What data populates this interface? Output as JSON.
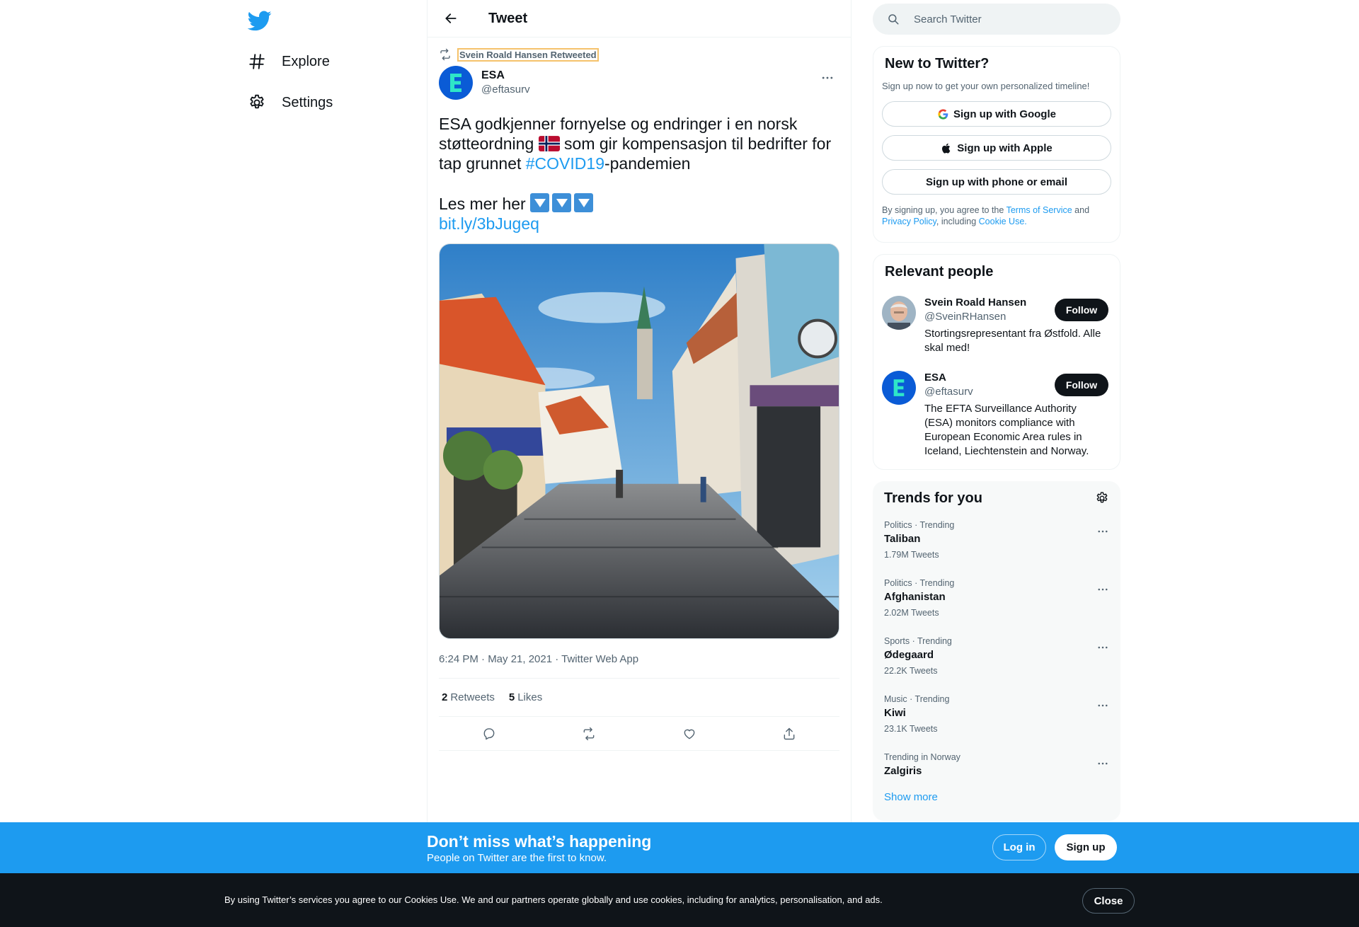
{
  "nav": {
    "explore_label": "Explore",
    "settings_label": "Settings"
  },
  "header": {
    "title": "Tweet"
  },
  "tweet": {
    "retweeted_by": "Svein Roald Hansen Retweeted",
    "author_name": "ESA",
    "author_handle": "@eftasurv",
    "text_part1": "ESA godkjenner fornyelse og endringer i en norsk støtteordning",
    "text_part2": "som gir kompensasjon til bedrifter for tap grunnet",
    "hashtag": "#COVID19",
    "text_part3": "-pandemien",
    "text_line2": "Les mer her",
    "link": "bit.ly/3bJugeq",
    "timestamp": "6:24 PM · May 21, 2021 · Twitter Web App",
    "retweets_count": "2",
    "retweets_label": "Retweets",
    "likes_count": "5",
    "likes_label": "Likes"
  },
  "search": {
    "placeholder": "Search Twitter"
  },
  "new_to_twitter": {
    "title": "New to Twitter?",
    "subtitle": "Sign up now to get your own personalized timeline!",
    "google_btn": "Sign up with Google",
    "apple_btn": "Sign up with Apple",
    "phone_btn": "Sign up with phone or email",
    "terms_prefix": "By signing up, you agree to the",
    "terms_link": "Terms of Service",
    "terms_and": "and",
    "privacy_link": "Privacy Policy",
    "terms_including": ", including",
    "cookie_link": "Cookie Use."
  },
  "relevant_people": {
    "title": "Relevant people",
    "people": [
      {
        "name": "Svein Roald Hansen",
        "handle": "@SveinRHansen",
        "bio": "Stortingsrepresentant fra Østfold. Alle skal med!",
        "follow_label": "Follow"
      },
      {
        "name": "ESA",
        "handle": "@eftasurv",
        "bio": "The EFTA Surveillance Authority (ESA) monitors compliance with European Economic Area rules in Iceland, Liechtenstein and Norway.",
        "follow_label": "Follow"
      }
    ]
  },
  "trends": {
    "title": "Trends for you",
    "items": [
      {
        "meta": "Politics · Trending",
        "name": "Taliban",
        "count": "1.79M Tweets"
      },
      {
        "meta": "Politics · Trending",
        "name": "Afghanistan",
        "count": "2.02M Tweets"
      },
      {
        "meta": "Sports · Trending",
        "name": "Ødegaard",
        "count": "22.2K Tweets"
      },
      {
        "meta": "Music · Trending",
        "name": "Kiwi",
        "count": "23.1K Tweets"
      },
      {
        "meta": "Trending in Norway",
        "name": "Zalgiris",
        "count": ""
      }
    ],
    "show_more": "Show more"
  },
  "banner": {
    "title": "Don’t miss what’s happening",
    "subtitle": "People on Twitter are the first to know.",
    "login": "Log in",
    "signup": "Sign up"
  },
  "cookie": {
    "text": "By using Twitter’s services you agree to our Cookies Use. We and our partners operate globally and use cookies, including for analytics, personalisation, and ads.",
    "close": "Close"
  },
  "colors": {
    "accent": "#1d9bf0",
    "text": "#0f1419",
    "muted": "#536471",
    "cookie_bg": "#0f1419"
  }
}
